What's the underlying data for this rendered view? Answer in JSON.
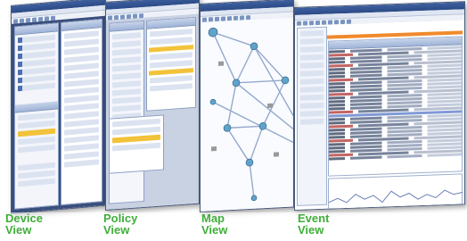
{
  "views": [
    {
      "id": "device",
      "line1": "Device",
      "line2": "View"
    },
    {
      "id": "policy",
      "line1": "Policy",
      "line2": "View"
    },
    {
      "id": "map",
      "line1": "Map",
      "line2": "View"
    },
    {
      "id": "event",
      "line1": "Event",
      "line2": "View"
    }
  ],
  "colors": {
    "label_green": "#3fae3a",
    "title_blue": "#2b4a86",
    "highlight_yellow": "#f2c23a",
    "event_orange": "#f08a2c"
  }
}
